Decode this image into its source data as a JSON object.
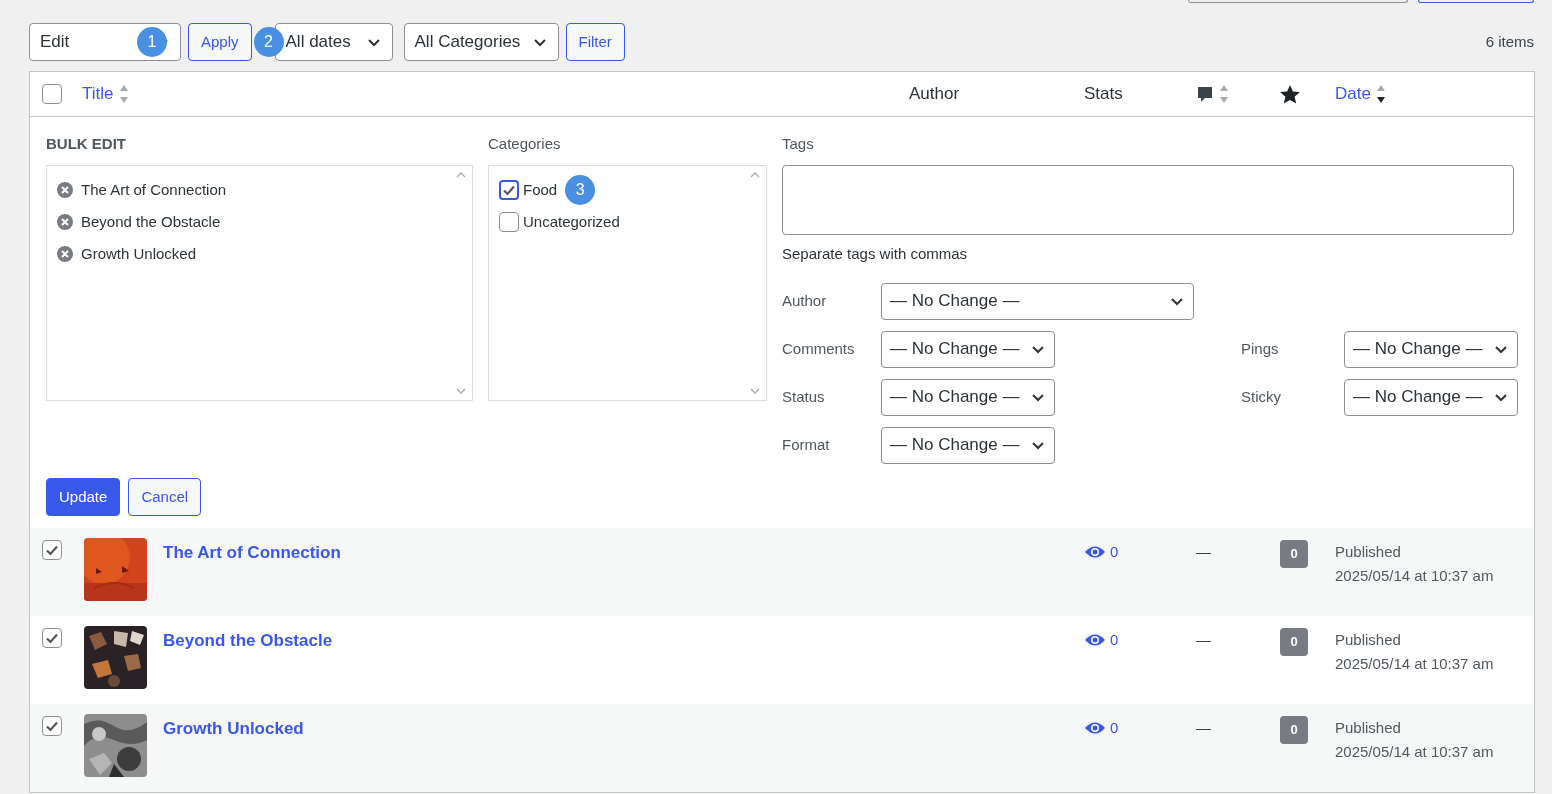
{
  "toolbar": {
    "bulk_action": {
      "value": "Edit",
      "marker": "1"
    },
    "apply_button": "Apply",
    "date_filter": {
      "value": "All dates",
      "marker": "2"
    },
    "category_filter": {
      "value": "All Categories"
    },
    "filter_button": "Filter",
    "item_count": "6 items"
  },
  "table": {
    "columns": [
      {
        "kind": "check",
        "checked": false
      },
      {
        "kind": "sortable",
        "label": "Title",
        "sorted": false
      },
      {
        "kind": "plain",
        "label": "Author"
      },
      {
        "kind": "plain",
        "label": "Stats"
      },
      {
        "kind": "comments",
        "sorted": false
      },
      {
        "kind": "star"
      },
      {
        "kind": "sortable",
        "label": "Date",
        "sorted": true
      }
    ],
    "bulk_edit": {
      "title": "BULK EDIT",
      "posts": [
        "The Art of Connection",
        "Beyond the Obstacle",
        "Growth Unlocked"
      ],
      "categories_label": "Categories",
      "categories": [
        {
          "label": "Food",
          "checked": true,
          "focused": true,
          "marker": "3"
        },
        {
          "label": "Uncategorized",
          "checked": false,
          "focused": false
        }
      ],
      "tags_label": "Tags",
      "tags_hint": "Separate tags with commas",
      "field_rows": [
        [
          {
            "label": "Author",
            "value": "— No Change —",
            "wide": true
          }
        ],
        [
          {
            "label": "Comments",
            "value": "— No Change —",
            "wide": false
          },
          {
            "label": "Pings",
            "value": "— No Change —",
            "wide": false
          }
        ],
        [
          {
            "label": "Status",
            "value": "— No Change —",
            "wide": false
          },
          {
            "label": "Sticky",
            "value": "— No Change —",
            "wide": false
          }
        ],
        [
          {
            "label": "Format",
            "value": "— No Change —",
            "wide": false
          }
        ]
      ],
      "update_button": "Update",
      "cancel_button": "Cancel"
    },
    "rows": [
      {
        "title": "The Art of Connection",
        "checked": true,
        "views": "0",
        "comments": "—",
        "count": "0",
        "status": "Published",
        "date": "2025/05/14 at 10:37 am"
      },
      {
        "title": "Beyond the Obstacle",
        "checked": true,
        "views": "0",
        "comments": "—",
        "count": "0",
        "status": "Published",
        "date": "2025/05/14 at 10:37 am"
      },
      {
        "title": "Growth Unlocked",
        "checked": true,
        "views": "0",
        "comments": "—",
        "count": "0",
        "status": "Published",
        "date": "2025/05/14 at 10:37 am"
      }
    ]
  }
}
